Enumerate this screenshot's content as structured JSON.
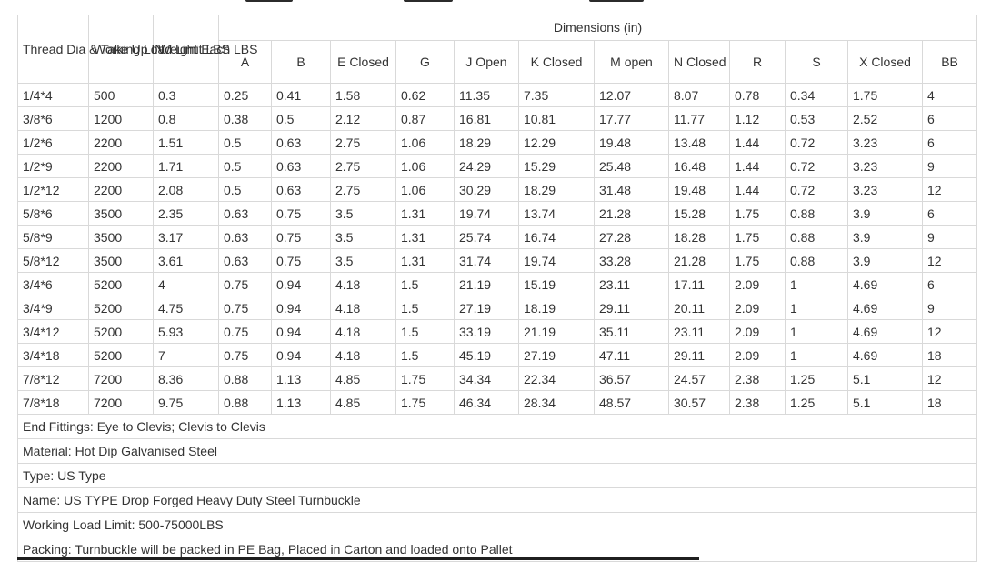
{
  "table": {
    "headers": {
      "thread": "Thread Dia & Take Up IN",
      "wll": "Working Load Limit LBS",
      "weight": "Weight Each LBS",
      "dimensions": "Dimensions (in)",
      "dims": [
        "A",
        "B",
        "E Closed",
        "G",
        "J Open",
        "K Closed",
        "M open",
        "N Closed",
        "R",
        "S",
        "X Closed",
        "BB"
      ]
    },
    "rows": [
      [
        "1/4*4",
        "500",
        "0.3",
        "0.25",
        "0.41",
        "1.58",
        "0.62",
        "11.35",
        "7.35",
        "12.07",
        "8.07",
        "0.78",
        "0.34",
        "1.75",
        "4"
      ],
      [
        "3/8*6",
        "1200",
        "0.8",
        "0.38",
        "0.5",
        "2.12",
        "0.87",
        "16.81",
        "10.81",
        "17.77",
        "11.77",
        "1.12",
        "0.53",
        "2.52",
        "6"
      ],
      [
        "1/2*6",
        "2200",
        "1.51",
        "0.5",
        "0.63",
        "2.75",
        "1.06",
        "18.29",
        "12.29",
        "19.48",
        "13.48",
        "1.44",
        "0.72",
        "3.23",
        "6"
      ],
      [
        "1/2*9",
        "2200",
        "1.71",
        "0.5",
        "0.63",
        "2.75",
        "1.06",
        "24.29",
        "15.29",
        "25.48",
        "16.48",
        "1.44",
        "0.72",
        "3.23",
        "9"
      ],
      [
        "1/2*12",
        "2200",
        "2.08",
        "0.5",
        "0.63",
        "2.75",
        "1.06",
        "30.29",
        "18.29",
        "31.48",
        "19.48",
        "1.44",
        "0.72",
        "3.23",
        "12"
      ],
      [
        "5/8*6",
        "3500",
        "2.35",
        "0.63",
        "0.75",
        "3.5",
        "1.31",
        "19.74",
        "13.74",
        "21.28",
        "15.28",
        "1.75",
        "0.88",
        "3.9",
        "6"
      ],
      [
        "5/8*9",
        "3500",
        "3.17",
        "0.63",
        "0.75",
        "3.5",
        "1.31",
        "25.74",
        "16.74",
        "27.28",
        "18.28",
        "1.75",
        "0.88",
        "3.9",
        "9"
      ],
      [
        "5/8*12",
        "3500",
        "3.61",
        "0.63",
        "0.75",
        "3.5",
        "1.31",
        "31.74",
        "19.74",
        "33.28",
        "21.28",
        "1.75",
        "0.88",
        "3.9",
        "12"
      ],
      [
        "3/4*6",
        "5200",
        "4",
        "0.75",
        "0.94",
        "4.18",
        "1.5",
        "21.19",
        "15.19",
        "23.11",
        "17.11",
        "2.09",
        "1",
        "4.69",
        "6"
      ],
      [
        "3/4*9",
        "5200",
        "4.75",
        "0.75",
        "0.94",
        "4.18",
        "1.5",
        "27.19",
        "18.19",
        "29.11",
        "20.11",
        "2.09",
        "1",
        "4.69",
        "9"
      ],
      [
        "3/4*12",
        "5200",
        "5.93",
        "0.75",
        "0.94",
        "4.18",
        "1.5",
        "33.19",
        "21.19",
        "35.11",
        "23.11",
        "2.09",
        "1",
        "4.69",
        "12"
      ],
      [
        "3/4*18",
        "5200",
        "7",
        "0.75",
        "0.94",
        "4.18",
        "1.5",
        "45.19",
        "27.19",
        "47.11",
        "29.11",
        "2.09",
        "1",
        "4.69",
        "18"
      ],
      [
        "7/8*12",
        "7200",
        "8.36",
        "0.88",
        "1.13",
        "4.85",
        "1.75",
        "34.34",
        "22.34",
        "36.57",
        "24.57",
        "2.38",
        "1.25",
        "5.1",
        "12"
      ],
      [
        "7/8*18",
        "7200",
        "9.75",
        "0.88",
        "1.13",
        "4.85",
        "1.75",
        "46.34",
        "28.34",
        "48.57",
        "30.57",
        "2.38",
        "1.25",
        "5.1",
        "18"
      ]
    ],
    "notes": [
      "End Fittings: Eye to Clevis; Clevis to Clevis",
      "Material: Hot Dip Galvanised Steel",
      "Type: US Type",
      "Name: US TYPE Drop Forged Heavy Duty Steel Turnbuckle",
      "Working Load Limit: 500-75000LBS",
      "Packing: Turnbuckle will be packed in PE Bag, Placed in Carton and loaded onto Pallet"
    ]
  }
}
